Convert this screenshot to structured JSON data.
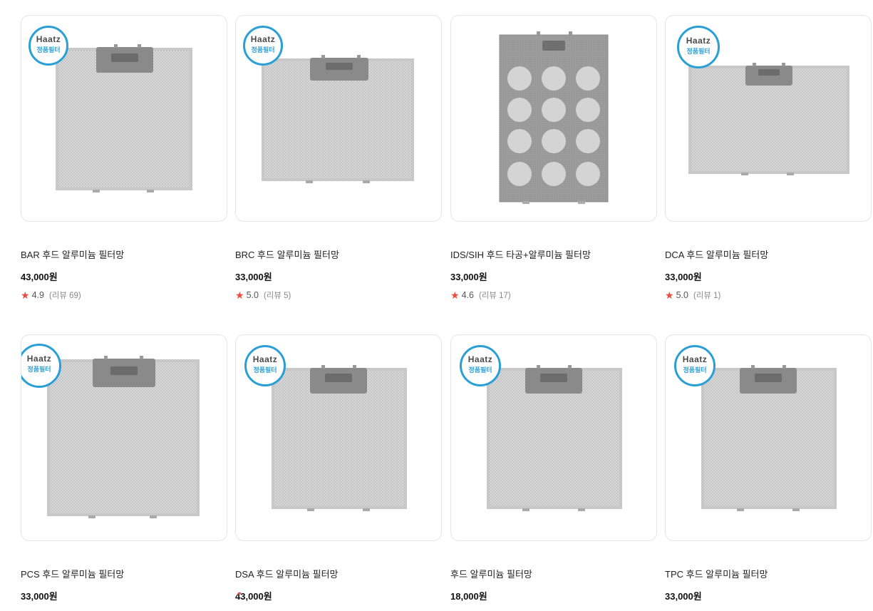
{
  "badge": {
    "brand": "Haatz",
    "label": "정품필터"
  },
  "products": [
    {
      "name": "BAR 후드 알루미늄 필터망",
      "price": "43,000원",
      "rating": "4.9",
      "reviews": "(리뷰 69)"
    },
    {
      "name": "BRC 후드 알루미늄 필터망",
      "price": "33,000원",
      "rating": "5.0",
      "reviews": "(리뷰 5)"
    },
    {
      "name": "IDS/SIH 후드 타공+알루미늄 필터망",
      "price": "33,000원",
      "rating": "4.6",
      "reviews": "(리뷰 17)"
    },
    {
      "name": "DCA 후드 알루미늄 필터망",
      "price": "33,000원",
      "rating": "5.0",
      "reviews": "(리뷰 1)"
    },
    {
      "name": "PCS 후드 알루미늄 필터망",
      "price": "33,000원"
    },
    {
      "name": "DSA 후드 알루미늄 필터망",
      "price": "43,000원"
    },
    {
      "name": "후드 알루미늄 필터망",
      "price": "18,000원"
    },
    {
      "name": "TPC 후드 알루미늄 필터망",
      "price": "33,000원"
    }
  ],
  "colors": {
    "star": "#f04a3e",
    "badge": "#2a9fd6",
    "card_border": "#e6e6e6",
    "filter_metal": "#d9d9d9",
    "handle": "#8a8a8a"
  },
  "icons": {
    "rating": "star-icon",
    "badge": "brand-badge-icon"
  }
}
